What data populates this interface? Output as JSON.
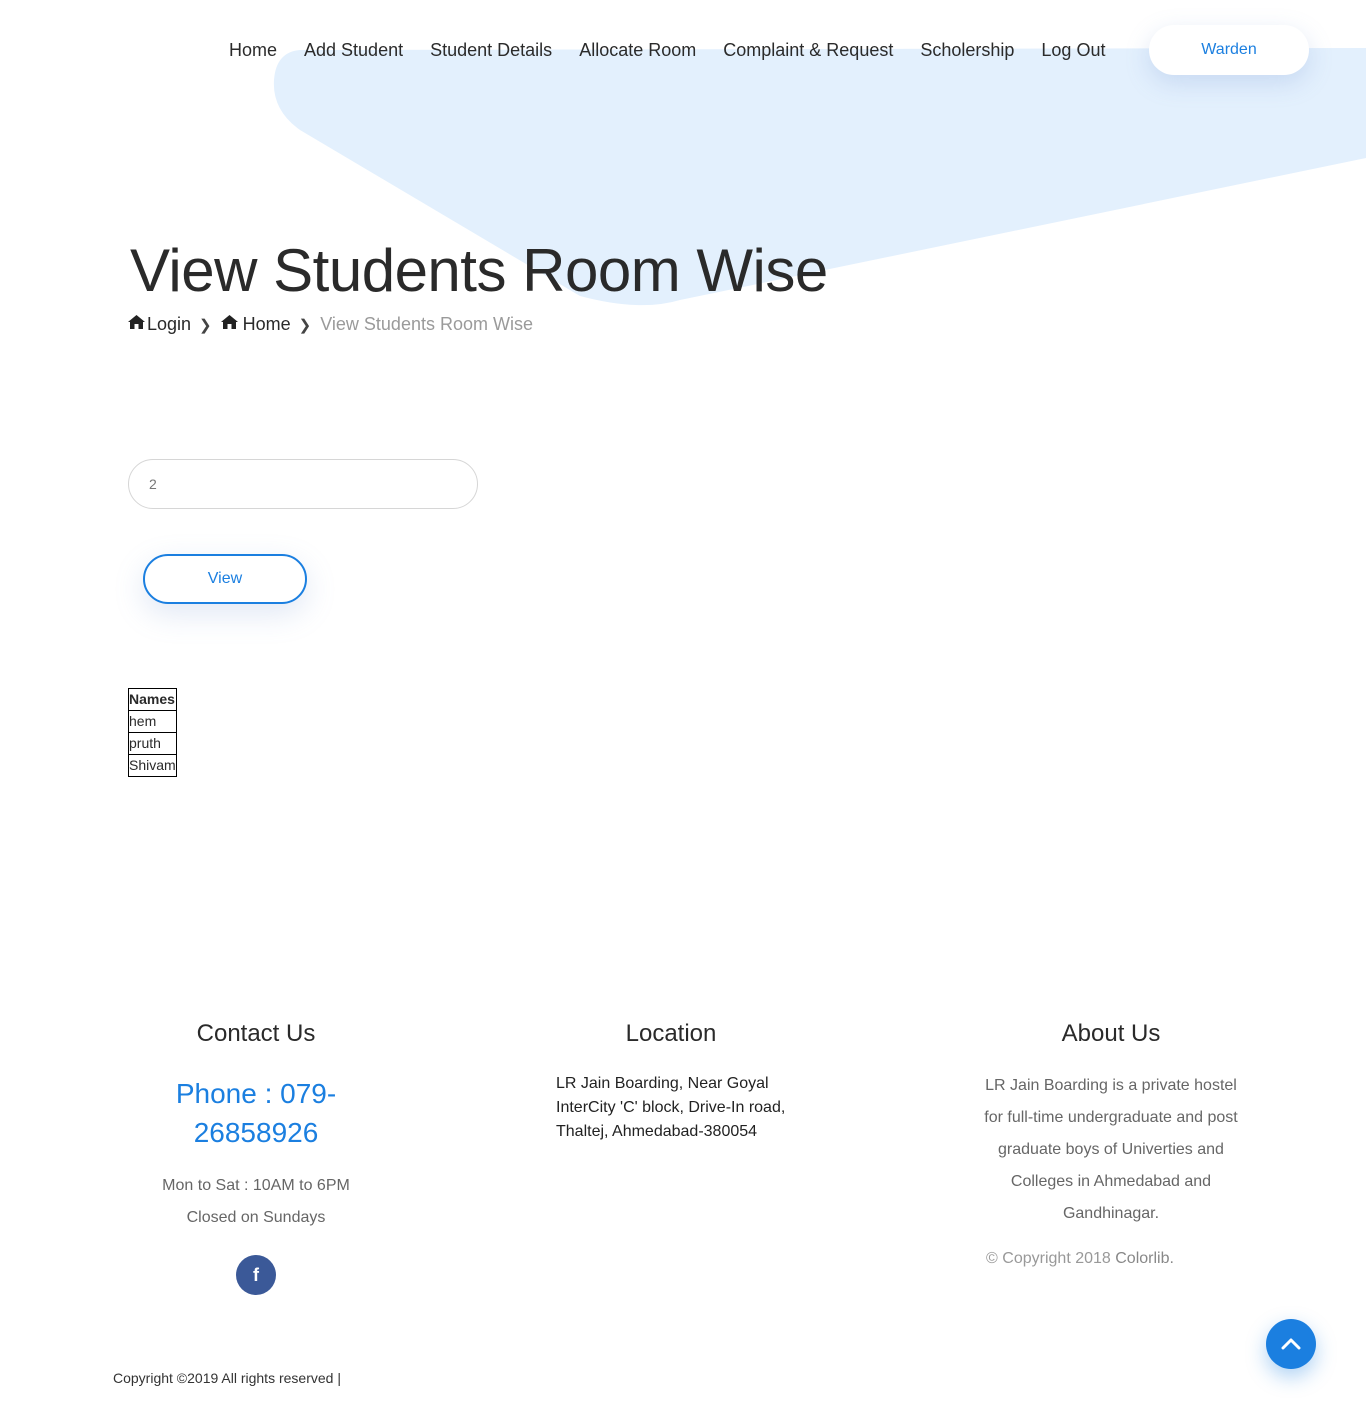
{
  "nav": {
    "items": [
      "Home",
      "Add Student",
      "Student Details",
      "Allocate Room",
      "Complaint & Request",
      "Scholership",
      "Log Out"
    ],
    "role_button": "Warden"
  },
  "page": {
    "title": "View Students Room Wise",
    "breadcrumb": {
      "login": "Login",
      "home": "Home",
      "current": "View Students Room Wise",
      "icon": "home-icon"
    }
  },
  "form": {
    "room_value": "2",
    "view_label": "View"
  },
  "table": {
    "header": "Names",
    "rows": [
      "hem",
      "pruth",
      "Shivam"
    ]
  },
  "footer": {
    "contact": {
      "title": "Contact Us",
      "phone": "Phone : 079-26858926",
      "hours_line1": "Mon to Sat : 10AM to 6PM",
      "hours_line2": "Closed on Sundays",
      "social_icon": "facebook-icon"
    },
    "location": {
      "title": "Location",
      "address": "LR Jain Boarding, Near Goyal InterCity 'C' block, Drive-In road, Thaltej, Ahmedabad-380054"
    },
    "about": {
      "title": "About Us",
      "text": "LR Jain Boarding is a private hostel for full-time undergraduate and post graduate boys of Univerties and Colleges in Ahmedabad and Gandhinagar.",
      "copyright_prefix": "© Copyright 2018 ",
      "copyright_brand": "Colorlib."
    },
    "bottom_copyright": "Copyright ©2019 All rights reserved |"
  },
  "colors": {
    "accent": "#1b7fe0",
    "shape": "#e3f0fd",
    "facebook": "#3b5998"
  }
}
